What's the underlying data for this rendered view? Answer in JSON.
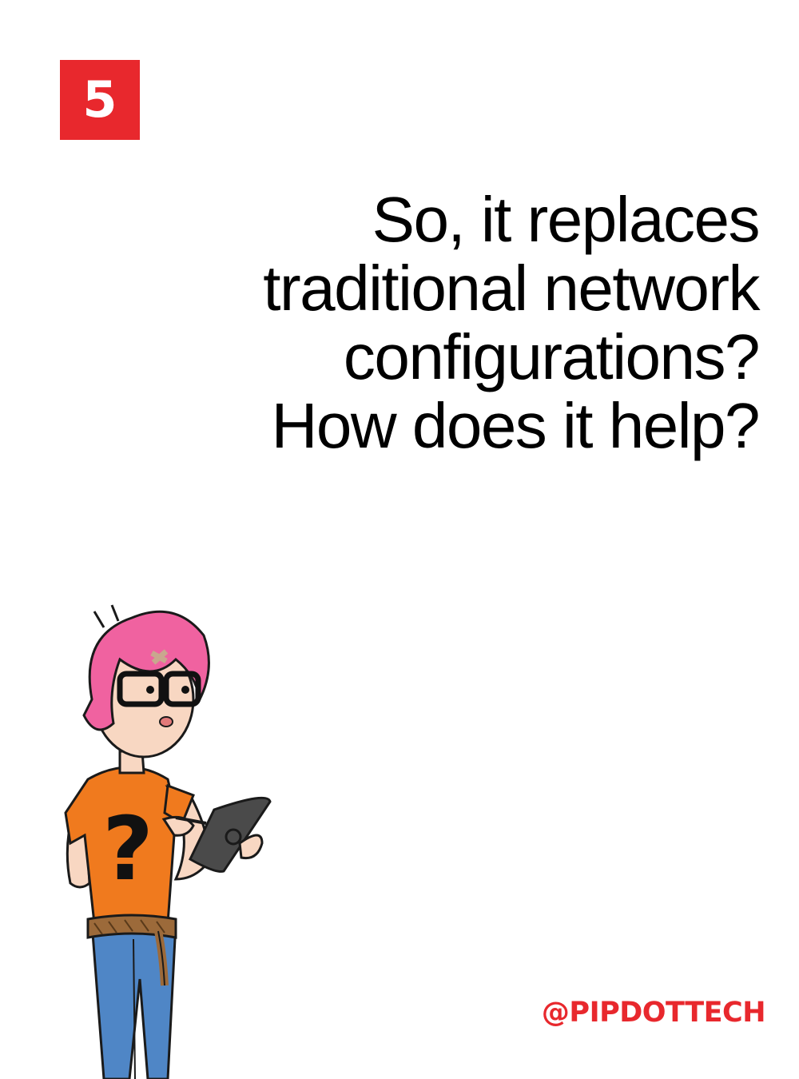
{
  "slide": {
    "number": "5",
    "question_lines": [
      "So, it replaces",
      "traditional network",
      "configurations?",
      "How does it help?"
    ],
    "handle": "@PIPDOTTECH",
    "shirt_mark": "?"
  },
  "colors": {
    "accent": "#e8282d",
    "hair": "#f062a0",
    "shirt": "#f07a1e",
    "jeans": "#4f86c6",
    "tablet": "#4a4a4a",
    "rope": "#9c6a3a",
    "skin": "#f8d7c2"
  },
  "icons": {
    "character": "confused-character-with-tablet-illustration"
  }
}
